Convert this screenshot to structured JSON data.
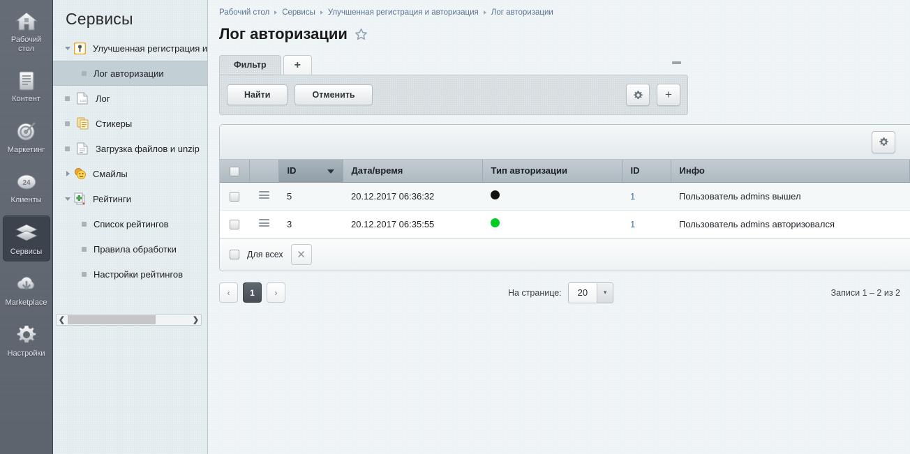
{
  "rail": {
    "items": [
      {
        "label": "Рабочий\nстол",
        "icon": "home-icon",
        "active": false
      },
      {
        "label": "Контент",
        "icon": "content-icon",
        "active": false
      },
      {
        "label": "Маркетинг",
        "icon": "target-icon",
        "active": false
      },
      {
        "label": "Клиенты",
        "icon": "clients-24-icon",
        "active": false
      },
      {
        "label": "Сервисы",
        "icon": "layers-icon",
        "active": true
      },
      {
        "label": "Marketplace",
        "icon": "cloud-download-icon",
        "active": false
      },
      {
        "label": "Настройки",
        "icon": "gear-icon",
        "active": false
      }
    ]
  },
  "sidebar": {
    "title": "Сервисы",
    "items": [
      {
        "label": "Улучшенная регистрация и",
        "icon": "key-icon",
        "twisty": "open",
        "level": 1,
        "selected": false
      },
      {
        "label": "Лог авторизации",
        "icon": "bullet",
        "twisty": "none",
        "level": 2,
        "selected": true
      },
      {
        "label": "Лог",
        "icon": "log-doc-icon",
        "twisty": "none",
        "level": 1,
        "selected": false
      },
      {
        "label": "Стикеры",
        "icon": "sticky-notes-icon",
        "twisty": "none",
        "level": 1,
        "selected": false
      },
      {
        "label": "Загрузка файлов и unzip",
        "icon": "doc-icon",
        "twisty": "none",
        "level": 1,
        "selected": false
      },
      {
        "label": "Смайлы",
        "icon": "smiley-icon",
        "twisty": "closed",
        "level": 1,
        "selected": false
      },
      {
        "label": "Рейтинги",
        "icon": "ratings-icon",
        "twisty": "open",
        "level": 1,
        "selected": false
      },
      {
        "label": "Список рейтингов",
        "icon": "bullet",
        "twisty": "none",
        "level": 2,
        "selected": false
      },
      {
        "label": "Правила обработки",
        "icon": "bullet",
        "twisty": "none",
        "level": 2,
        "selected": false
      },
      {
        "label": "Настройки рейтингов",
        "icon": "bullet",
        "twisty": "none",
        "level": 2,
        "selected": false
      }
    ]
  },
  "breadcrumb": [
    "Рабочий стол",
    "Сервисы",
    "Улучшенная регистрация и авторизация",
    "Лог авторизации"
  ],
  "page": {
    "title": "Лог авторизации",
    "favorite_icon": "star-outline-icon"
  },
  "filter": {
    "tab_label": "Фильтр",
    "add_tab_label": "+",
    "search_button": "Найти",
    "cancel_button": "Отменить",
    "settings_icon": "gear-icon",
    "add_icon": "plus-icon",
    "minimize_icon": "minimize-icon"
  },
  "grid": {
    "settings_icon": "gear-icon",
    "columns": [
      "",
      "",
      "ID",
      "Дата/время",
      "Тип авторизации",
      "ID",
      "Инфо"
    ],
    "sorted_column_index": 2,
    "sort_direction": "desc",
    "rows": [
      {
        "id": "5",
        "datetime": "20.12.2017 06:36:32",
        "type_color": "#111111",
        "user_id": "1",
        "info": "Пользователь admins вышел"
      },
      {
        "id": "3",
        "datetime": "20.12.2017 06:35:55",
        "type_color": "#00cc22",
        "user_id": "1",
        "info": "Пользователь admins авторизовался"
      }
    ],
    "footer": {
      "for_all_label": "Для всех",
      "clear_icon": "close-icon"
    }
  },
  "pagination": {
    "prev_label": "‹",
    "next_label": "›",
    "current_page": "1",
    "per_page_label": "На странице:",
    "per_page_value": "20",
    "records_info": "Записи 1 – 2 из 2"
  },
  "colors": {
    "accent_link": "#3b6fa8",
    "rail_bg": "#5f6670",
    "sidebar_bg": "#e2ecef",
    "selected_row": "#c2d0d6",
    "header_bg": "#aeb9c0"
  }
}
